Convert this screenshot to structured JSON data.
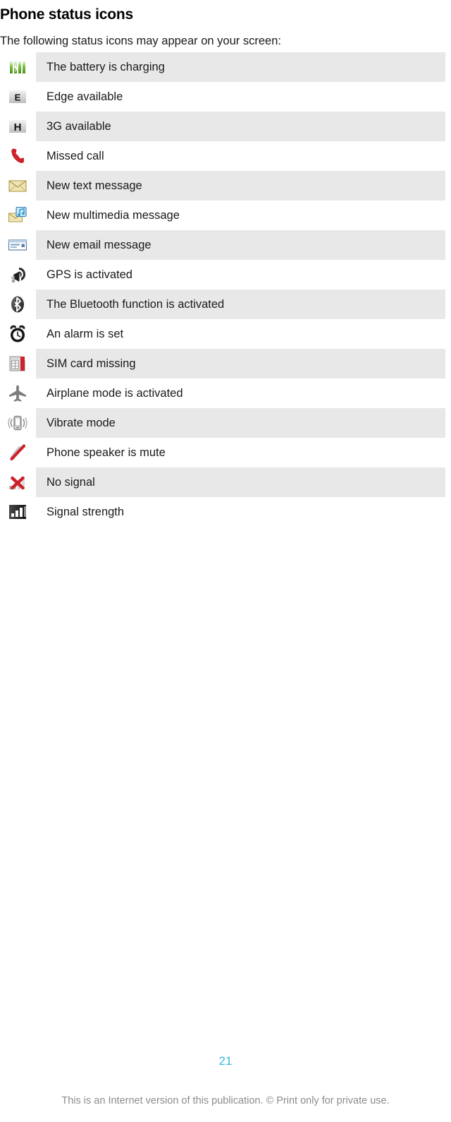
{
  "document": {
    "title": "Phone status icons",
    "intro": "The following status icons may appear on your screen:",
    "page_number": "21",
    "footer_note": "This is an Internet version of this publication. © Print only for private use."
  },
  "colors": {
    "row_shade": "#e8e8e8",
    "page_number": "#3cb4e5",
    "footer_text": "#8c8c8c",
    "body_text": "#1a1a1a",
    "battery_green": "#7ac143",
    "accent_red": "#cc2229",
    "mms_blue": "#2e9bd6",
    "envelope_yellow": "#e8d89a",
    "dark_gray": "#3a3a3a"
  },
  "status_icons": [
    {
      "icon": "battery-charging-icon",
      "label": "The battery is charging",
      "shaded": true
    },
    {
      "icon": "edge-network-icon",
      "label": "Edge available",
      "shaded": false
    },
    {
      "icon": "hsdpa-3g-network-icon",
      "label": "3G available",
      "shaded": true
    },
    {
      "icon": "missed-call-icon",
      "label": "Missed call",
      "shaded": false
    },
    {
      "icon": "new-text-message-icon",
      "label": "New text message",
      "shaded": true
    },
    {
      "icon": "new-multimedia-message-icon",
      "label": "New multimedia message",
      "shaded": false
    },
    {
      "icon": "new-email-message-icon",
      "label": "New email message",
      "shaded": true
    },
    {
      "icon": "gps-activated-icon",
      "label": "GPS is activated",
      "shaded": false
    },
    {
      "icon": "bluetooth-activated-icon",
      "label": "The Bluetooth function is activated",
      "shaded": true
    },
    {
      "icon": "alarm-set-icon",
      "label": "An alarm is set",
      "shaded": false
    },
    {
      "icon": "sim-card-missing-icon",
      "label": "SIM card missing",
      "shaded": true
    },
    {
      "icon": "airplane-mode-icon",
      "label": "Airplane mode is activated",
      "shaded": false
    },
    {
      "icon": "vibrate-mode-icon",
      "label": "Vibrate mode",
      "shaded": true
    },
    {
      "icon": "speaker-mute-icon",
      "label": "Phone speaker is mute",
      "shaded": false
    },
    {
      "icon": "no-signal-icon",
      "label": "No signal",
      "shaded": true
    },
    {
      "icon": "signal-strength-icon",
      "label": "Signal strength",
      "shaded": false
    }
  ]
}
